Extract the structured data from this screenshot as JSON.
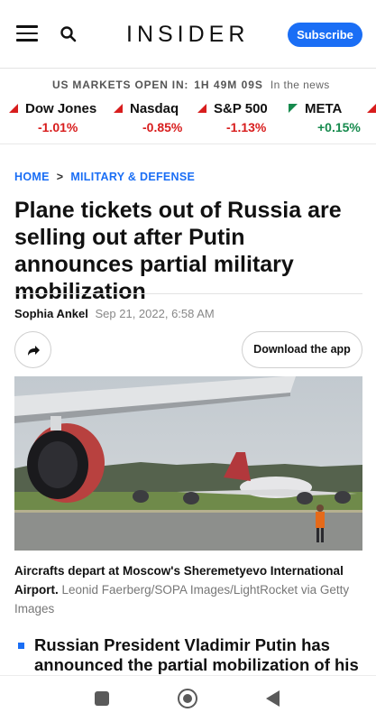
{
  "header": {
    "logo": "INSIDER",
    "subscribe_label": "Subscribe",
    "menu_icon": "hamburger-menu-icon",
    "search_icon": "search-icon",
    "brand_color": "#1a6ef5"
  },
  "markets": {
    "status_label": "US MARKETS OPEN IN:",
    "countdown": "1H 49M 09S",
    "news_link": "In the news",
    "tickers": [
      {
        "name": "Dow Jones",
        "change": "-1.01%",
        "direction": "down",
        "color": "#d81d1d"
      },
      {
        "name": "Nasdaq",
        "change": "-0.85%",
        "direction": "down",
        "color": "#d81d1d"
      },
      {
        "name": "S&P 500",
        "change": "-1.13%",
        "direction": "down",
        "color": "#d81d1d"
      },
      {
        "name": "META",
        "change": "+0.15%",
        "direction": "up",
        "color": "#168a4d"
      }
    ]
  },
  "breadcrumb": {
    "home": "HOME",
    "separator": ">",
    "section": "MILITARY & DEFENSE"
  },
  "article": {
    "title": "Plane tickets out of Russia are selling out after Putin announces partial military mobilization",
    "author": "Sophia Ankel",
    "date": "Sep 21, 2022, 6:58 AM",
    "share_icon": "share-arrow-icon",
    "download_label": "Download the app",
    "caption_main": "Aircrafts depart at Moscow's Sheremetyevo International Airport.",
    "caption_credit": "Leonid Faerberg/SOPA Images/LightRocket via Getty Images",
    "bullet_text": "Russian President Vladimir Putin has announced the partial mobilization of his"
  },
  "system_nav": {
    "recents_icon": "recents-square-icon",
    "home_icon": "home-circle-icon",
    "back_icon": "back-triangle-icon"
  }
}
